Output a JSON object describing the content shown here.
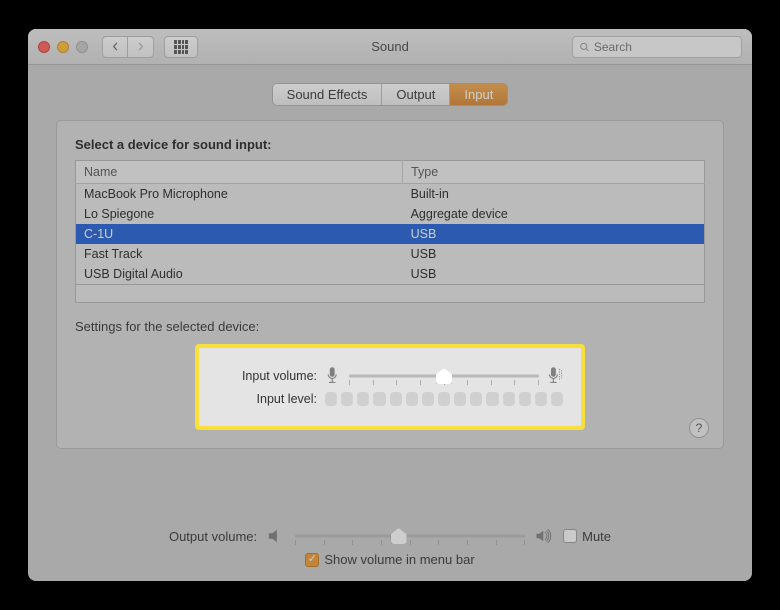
{
  "window": {
    "title": "Sound"
  },
  "search": {
    "placeholder": "Search"
  },
  "tabs": [
    {
      "label": "Sound Effects"
    },
    {
      "label": "Output"
    },
    {
      "label": "Input",
      "active": true
    }
  ],
  "panel": {
    "heading": "Select a device for sound input:",
    "columns": {
      "name": "Name",
      "type": "Type"
    },
    "devices": [
      {
        "name": "MacBook Pro Microphone",
        "type": "Built-in"
      },
      {
        "name": "Lo Spiegone",
        "type": "Aggregate device"
      },
      {
        "name": "C-1U",
        "type": "USB",
        "selected": true
      },
      {
        "name": "Fast Track",
        "type": "USB"
      },
      {
        "name": "USB Digital Audio",
        "type": "USB"
      }
    ],
    "settings_label": "Settings for the selected device:",
    "input_volume_label": "Input volume:",
    "input_volume_value": 0.5,
    "input_level_label": "Input level:",
    "input_level_segments": 15,
    "help": "?"
  },
  "footer": {
    "output_volume_label": "Output volume:",
    "output_volume_value": 0.45,
    "mute_label": "Mute",
    "mute_checked": false,
    "show_menu_label": "Show volume in menu bar",
    "show_menu_checked": true
  }
}
